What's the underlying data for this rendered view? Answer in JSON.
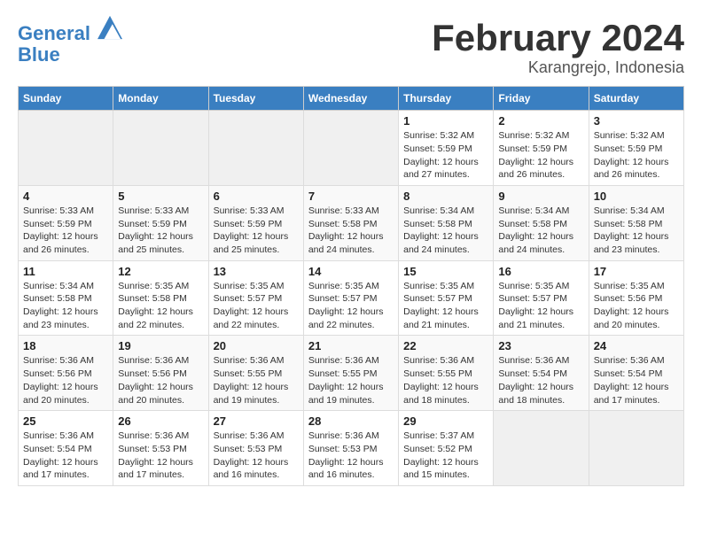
{
  "header": {
    "logo_line1": "General",
    "logo_line2": "Blue",
    "month": "February 2024",
    "location": "Karangrejo, Indonesia"
  },
  "days_of_week": [
    "Sunday",
    "Monday",
    "Tuesday",
    "Wednesday",
    "Thursday",
    "Friday",
    "Saturday"
  ],
  "weeks": [
    [
      {
        "day": "",
        "info": ""
      },
      {
        "day": "",
        "info": ""
      },
      {
        "day": "",
        "info": ""
      },
      {
        "day": "",
        "info": ""
      },
      {
        "day": "1",
        "info": "Sunrise: 5:32 AM\nSunset: 5:59 PM\nDaylight: 12 hours\nand 27 minutes."
      },
      {
        "day": "2",
        "info": "Sunrise: 5:32 AM\nSunset: 5:59 PM\nDaylight: 12 hours\nand 26 minutes."
      },
      {
        "day": "3",
        "info": "Sunrise: 5:32 AM\nSunset: 5:59 PM\nDaylight: 12 hours\nand 26 minutes."
      }
    ],
    [
      {
        "day": "4",
        "info": "Sunrise: 5:33 AM\nSunset: 5:59 PM\nDaylight: 12 hours\nand 26 minutes."
      },
      {
        "day": "5",
        "info": "Sunrise: 5:33 AM\nSunset: 5:59 PM\nDaylight: 12 hours\nand 25 minutes."
      },
      {
        "day": "6",
        "info": "Sunrise: 5:33 AM\nSunset: 5:59 PM\nDaylight: 12 hours\nand 25 minutes."
      },
      {
        "day": "7",
        "info": "Sunrise: 5:33 AM\nSunset: 5:58 PM\nDaylight: 12 hours\nand 24 minutes."
      },
      {
        "day": "8",
        "info": "Sunrise: 5:34 AM\nSunset: 5:58 PM\nDaylight: 12 hours\nand 24 minutes."
      },
      {
        "day": "9",
        "info": "Sunrise: 5:34 AM\nSunset: 5:58 PM\nDaylight: 12 hours\nand 24 minutes."
      },
      {
        "day": "10",
        "info": "Sunrise: 5:34 AM\nSunset: 5:58 PM\nDaylight: 12 hours\nand 23 minutes."
      }
    ],
    [
      {
        "day": "11",
        "info": "Sunrise: 5:34 AM\nSunset: 5:58 PM\nDaylight: 12 hours\nand 23 minutes."
      },
      {
        "day": "12",
        "info": "Sunrise: 5:35 AM\nSunset: 5:58 PM\nDaylight: 12 hours\nand 22 minutes."
      },
      {
        "day": "13",
        "info": "Sunrise: 5:35 AM\nSunset: 5:57 PM\nDaylight: 12 hours\nand 22 minutes."
      },
      {
        "day": "14",
        "info": "Sunrise: 5:35 AM\nSunset: 5:57 PM\nDaylight: 12 hours\nand 22 minutes."
      },
      {
        "day": "15",
        "info": "Sunrise: 5:35 AM\nSunset: 5:57 PM\nDaylight: 12 hours\nand 21 minutes."
      },
      {
        "day": "16",
        "info": "Sunrise: 5:35 AM\nSunset: 5:57 PM\nDaylight: 12 hours\nand 21 minutes."
      },
      {
        "day": "17",
        "info": "Sunrise: 5:35 AM\nSunset: 5:56 PM\nDaylight: 12 hours\nand 20 minutes."
      }
    ],
    [
      {
        "day": "18",
        "info": "Sunrise: 5:36 AM\nSunset: 5:56 PM\nDaylight: 12 hours\nand 20 minutes."
      },
      {
        "day": "19",
        "info": "Sunrise: 5:36 AM\nSunset: 5:56 PM\nDaylight: 12 hours\nand 20 minutes."
      },
      {
        "day": "20",
        "info": "Sunrise: 5:36 AM\nSunset: 5:55 PM\nDaylight: 12 hours\nand 19 minutes."
      },
      {
        "day": "21",
        "info": "Sunrise: 5:36 AM\nSunset: 5:55 PM\nDaylight: 12 hours\nand 19 minutes."
      },
      {
        "day": "22",
        "info": "Sunrise: 5:36 AM\nSunset: 5:55 PM\nDaylight: 12 hours\nand 18 minutes."
      },
      {
        "day": "23",
        "info": "Sunrise: 5:36 AM\nSunset: 5:54 PM\nDaylight: 12 hours\nand 18 minutes."
      },
      {
        "day": "24",
        "info": "Sunrise: 5:36 AM\nSunset: 5:54 PM\nDaylight: 12 hours\nand 17 minutes."
      }
    ],
    [
      {
        "day": "25",
        "info": "Sunrise: 5:36 AM\nSunset: 5:54 PM\nDaylight: 12 hours\nand 17 minutes."
      },
      {
        "day": "26",
        "info": "Sunrise: 5:36 AM\nSunset: 5:53 PM\nDaylight: 12 hours\nand 17 minutes."
      },
      {
        "day": "27",
        "info": "Sunrise: 5:36 AM\nSunset: 5:53 PM\nDaylight: 12 hours\nand 16 minutes."
      },
      {
        "day": "28",
        "info": "Sunrise: 5:36 AM\nSunset: 5:53 PM\nDaylight: 12 hours\nand 16 minutes."
      },
      {
        "day": "29",
        "info": "Sunrise: 5:37 AM\nSunset: 5:52 PM\nDaylight: 12 hours\nand 15 minutes."
      },
      {
        "day": "",
        "info": ""
      },
      {
        "day": "",
        "info": ""
      }
    ]
  ]
}
